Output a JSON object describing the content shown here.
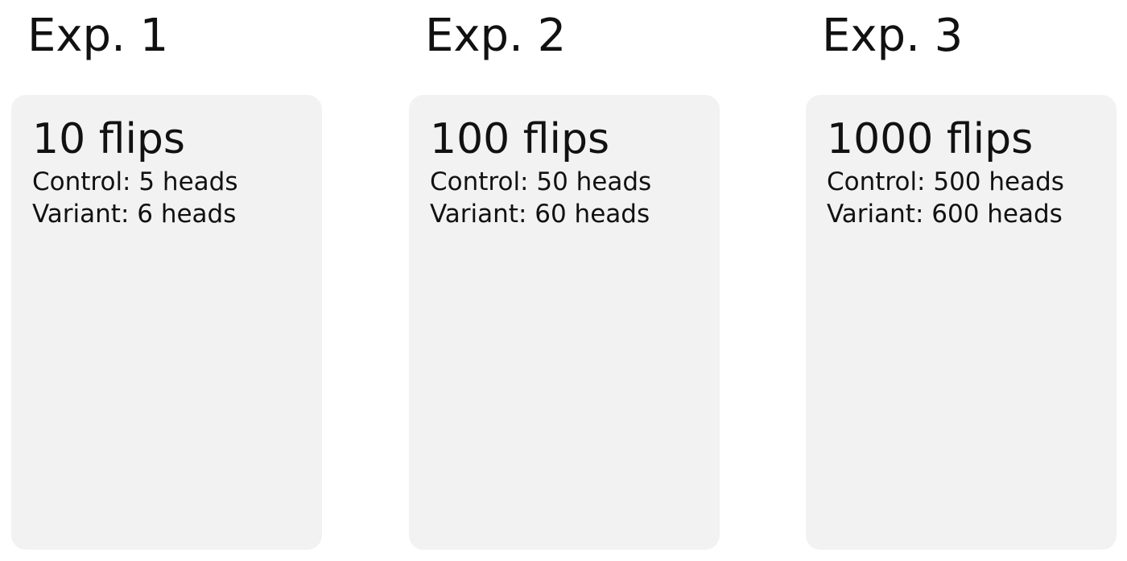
{
  "experiments": [
    {
      "title": "Exp. 1",
      "flips": "10 flips",
      "control": "Control: 5 heads",
      "variant": "Variant: 6 heads"
    },
    {
      "title": "Exp. 2",
      "flips": "100 flips",
      "control": "Control: 50 heads",
      "variant": "Variant: 60 heads"
    },
    {
      "title": "Exp. 3",
      "flips": "1000 flips",
      "control": "Control: 500 heads",
      "variant": "Variant: 600 heads"
    }
  ],
  "colors": {
    "background": "#ffffff",
    "card": "#f2f2f2",
    "text": "#111111"
  }
}
